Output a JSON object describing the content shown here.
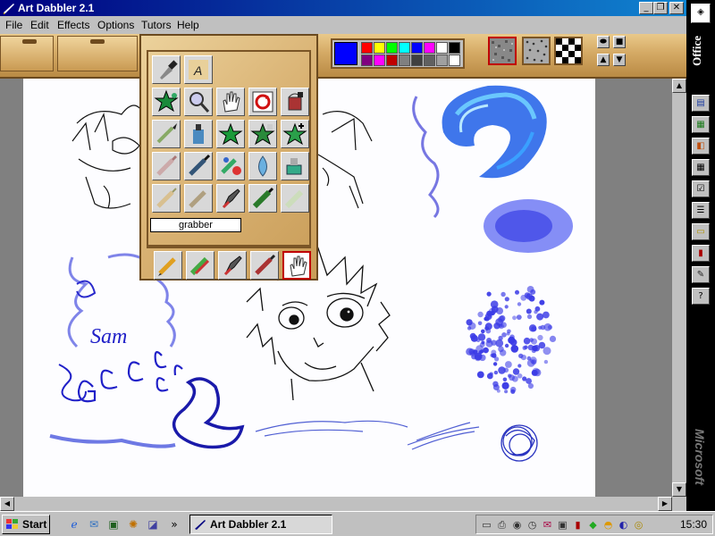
{
  "window": {
    "title": "Art Dabbler 2.1",
    "caption_buttons": [
      "minimize",
      "restore",
      "close"
    ]
  },
  "menu": [
    "File",
    "Edit",
    "Effects",
    "Options",
    "Tutors",
    "Help"
  ],
  "toolbar": {
    "colors": {
      "foreground": "#0000ff",
      "palette_row1": [
        "#ff0000",
        "#ffff00",
        "#00ff00",
        "#00ffff",
        "#0000ff",
        "#ff00ff",
        "#ffffff",
        "#000000"
      ],
      "palette_row2": [
        "#800080",
        "#ff00ff",
        "#c00000",
        "#808080",
        "#404040",
        "#606060",
        "#a0a0a0",
        "#ffffff"
      ]
    },
    "textures": [
      "noise-texture",
      "speckle-texture",
      "checker-texture"
    ],
    "selected_texture": "noise-texture"
  },
  "tools": {
    "rows": [
      [
        "eyedropper",
        "text"
      ],
      [
        "star-stamp",
        "magnifier",
        "grabber-hand",
        "rotate",
        "paint-bucket"
      ],
      [
        "brush",
        "spray-bottle",
        "green-star",
        "star-sponge",
        "star-plus"
      ],
      [
        "felt-pen-faded",
        "brush-dark",
        "paint-splash",
        "water-drop",
        "airbrush"
      ],
      [
        "pencil-faded",
        "brush-faded",
        "pen-nib",
        "marker",
        "chalk"
      ]
    ],
    "selected_name": "grabber",
    "drawers": [
      "pencil",
      "crayon",
      "pen-nib",
      "felt-pen",
      "grabber-hand"
    ],
    "selected_drawer": "grabber-hand"
  },
  "canvas": {
    "text": "Sam"
  },
  "office": {
    "label": "Office",
    "brand": "Microsoft",
    "buttons": [
      "word",
      "excel",
      "powerpoint",
      "calendar",
      "tasks",
      "contacts",
      "notes",
      "book",
      "help",
      "question"
    ]
  },
  "taskbar": {
    "start": "Start",
    "task": "Art Dabbler 2.1",
    "clock": "15:30",
    "quick_launch": [
      "internet-explorer",
      "outlook",
      "desktop",
      "channels",
      "launch"
    ]
  }
}
